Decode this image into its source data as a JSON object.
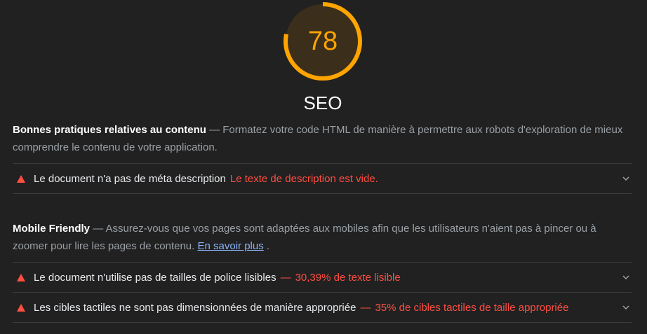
{
  "score": {
    "value": "78",
    "fraction": 0.78,
    "title": "SEO",
    "color": "#ffa400"
  },
  "groups": [
    {
      "title": "Bonnes pratiques relatives au contenu",
      "description": "Formatez votre code HTML de manière à permettre aux robots d'exploration de mieux comprendre le contenu de votre application.",
      "audits": [
        {
          "icon": "fail-triangle-icon",
          "title": "Le document n'a pas de méta description",
          "display": "Le texte de description est vide."
        }
      ]
    },
    {
      "title": "Mobile Friendly",
      "description": "Assurez-vous que vos pages sont adaptées aux mobiles afin que les utilisateurs n'aient pas à pincer ou à zoomer pour lire les pages de contenu.",
      "link": "En savoir plus",
      "after_link": ".",
      "audits": [
        {
          "icon": "fail-triangle-icon",
          "title": "Le document n'utilise pas de tailles de police lisibles",
          "separator": "—",
          "display": "30,39% de texte lisible"
        },
        {
          "icon": "fail-triangle-icon",
          "title": "Les cibles tactiles ne sont pas dimensionnées de manière appropriée",
          "separator": "—",
          "display": "35% de cibles tactiles de taille appropriée"
        }
      ]
    }
  ],
  "dash": "—",
  "colors": {
    "fail": "#ff4e42",
    "average": "#ffa400",
    "link": "#8ab4f8",
    "background": "#212121"
  }
}
